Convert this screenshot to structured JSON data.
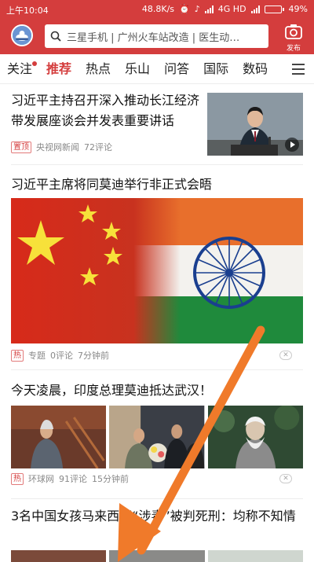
{
  "status_bar": {
    "time": "上午10:04",
    "speed": "48.8K/s",
    "network": "4G HD",
    "battery": "49%",
    "battery_level": 0.49
  },
  "header": {
    "search_placeholder": "三星手机 | 广州火车站改造 | 医生动…",
    "publish_label": "发布"
  },
  "tabs": [
    {
      "label": "关注",
      "has_dot": true
    },
    {
      "label": "推荐",
      "active": true
    },
    {
      "label": "热点"
    },
    {
      "label": "乐山"
    },
    {
      "label": "问答"
    },
    {
      "label": "国际"
    },
    {
      "label": "数码"
    }
  ],
  "articles": [
    {
      "title": "习近平主持召开深入推动长江经济带发展座谈会并发表重要讲话",
      "badge": "置顶",
      "source": "央视网新闻",
      "comments": "72评论",
      "thumb": "video"
    },
    {
      "title": "习近平主席将同莫迪举行非正式会晤",
      "badge": "热",
      "source": "专题",
      "comments": "0评论",
      "time": "7分钟前"
    },
    {
      "title": "今天凌晨，印度总理莫迪抵达武汉！",
      "badge": "热",
      "source": "环球网",
      "comments": "91评论",
      "time": "15分钟前"
    },
    {
      "title": "3名中国女孩马来西亚“涉毒”被判死刑：均称不知情"
    }
  ],
  "colors": {
    "brand_red": "#d43d3d",
    "arrow_orange": "#f07a2a"
  }
}
